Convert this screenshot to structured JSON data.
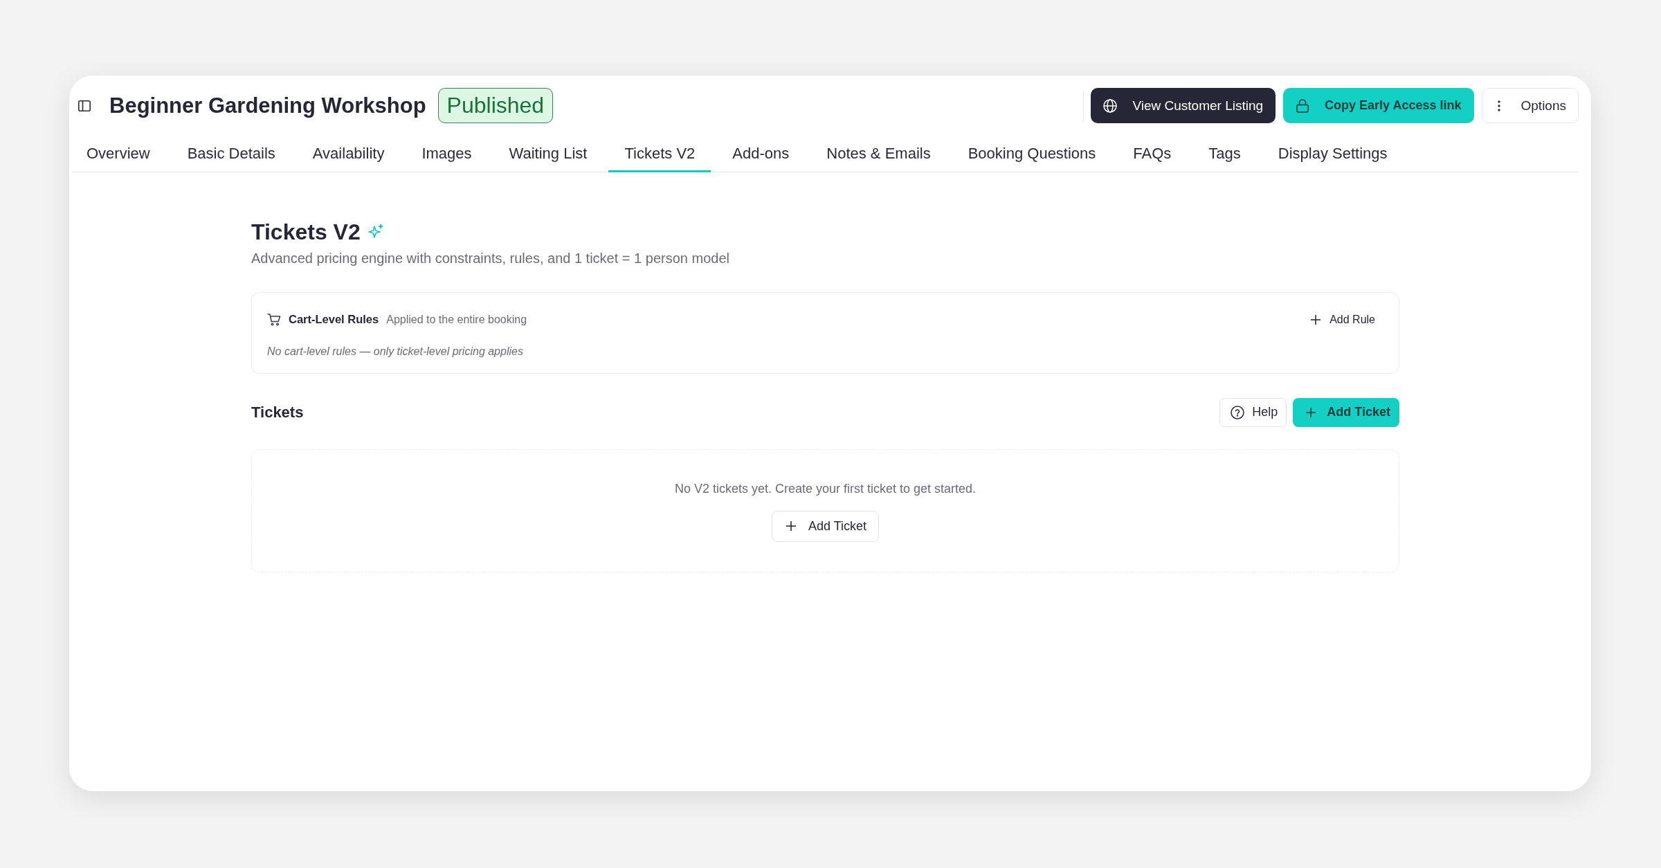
{
  "header": {
    "title": "Beginner Gardening Workshop",
    "status": "Published",
    "actions": [
      {
        "kind": "dark",
        "label": "View Customer Listing"
      },
      {
        "kind": "accent",
        "label": "Copy Early Access link"
      },
      {
        "kind": "outline",
        "label": "Options"
      }
    ]
  },
  "tabs": [
    {
      "label": "Overview",
      "selected": false
    },
    {
      "label": "Basic Details",
      "selected": false
    },
    {
      "label": "Availability",
      "selected": false
    },
    {
      "label": "Images",
      "selected": false
    },
    {
      "label": "Waiting List",
      "selected": false
    },
    {
      "label": "Tickets V2",
      "selected": true
    },
    {
      "label": "Add-ons",
      "selected": false
    },
    {
      "label": "Notes & Emails",
      "selected": false
    },
    {
      "label": "Booking Questions",
      "selected": false
    },
    {
      "label": "FAQs",
      "selected": false
    },
    {
      "label": "Tags",
      "selected": false
    },
    {
      "label": "Display Settings",
      "selected": false
    }
  ],
  "page": {
    "title": "Tickets V2",
    "subtitle": "Advanced pricing engine with constraints, rules, and 1 ticket = 1 person model"
  },
  "cart_rules": {
    "title": "Cart-Level Rules",
    "description": "Applied to the entire booking",
    "action": "Add Rule",
    "empty_text": "No cart-level rules — only ticket-level pricing applies"
  },
  "tickets": {
    "title": "Tickets",
    "actions": [
      {
        "kind": "outline",
        "label": "Help"
      },
      {
        "kind": "accent",
        "label": "Add Ticket"
      }
    ],
    "empty_text": "No V2 tickets yet. Create your first ticket to get started.",
    "empty_action": "Add Ticket"
  }
}
